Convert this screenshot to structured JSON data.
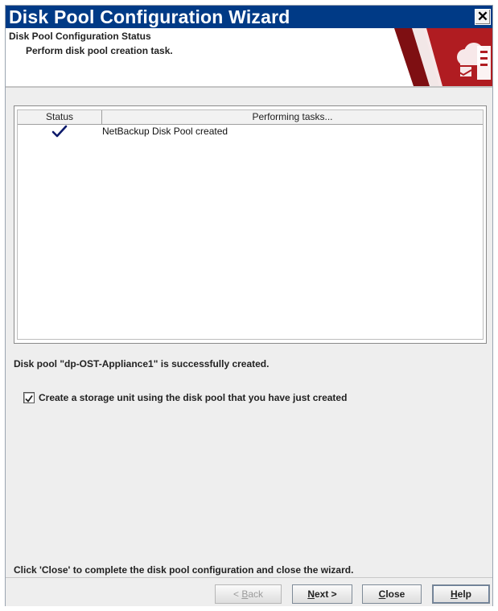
{
  "window": {
    "title": "Disk Pool Configuration Wizard",
    "close_glyph": "✕"
  },
  "banner": {
    "title": "Disk Pool Configuration Status",
    "subtitle": "Perform disk pool creation task.",
    "graphic_icon": "disk-pool-cloud-server-icon",
    "accent_color": "#a4161a"
  },
  "tasks_table": {
    "columns": [
      "Status",
      "Performing tasks..."
    ],
    "rows": [
      {
        "status_icon": "checkmark-icon",
        "task": "NetBackup Disk Pool created"
      }
    ]
  },
  "result_message": "Disk pool \"dp-OST-Appliance1\" is successfully created.",
  "storage_unit_checkbox": {
    "checked": true,
    "label": "Create a storage unit using the disk pool that you have just created"
  },
  "footer_message": "Click 'Close' to complete the disk pool configuration and close the wizard.",
  "buttons": {
    "back": {
      "pre": "< ",
      "mnemonic": "B",
      "post": "ack"
    },
    "next": {
      "mnemonic": "N",
      "post": "ext >"
    },
    "close": {
      "mnemonic": "C",
      "post": "lose"
    },
    "help": {
      "mnemonic": "H",
      "post": "elp"
    }
  }
}
